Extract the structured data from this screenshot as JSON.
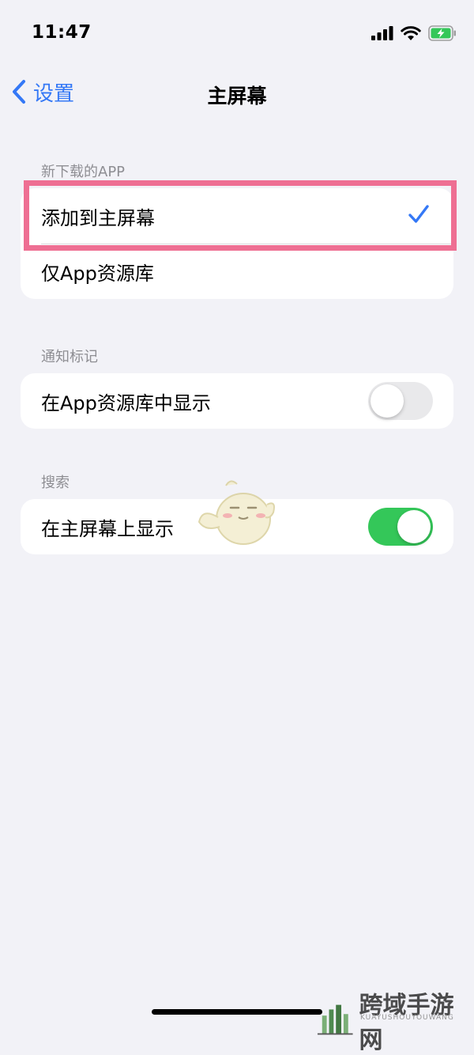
{
  "status_bar": {
    "time": "11:47"
  },
  "nav": {
    "back_label": "设置",
    "title": "主屏幕"
  },
  "sections": [
    {
      "header": "新下载的APP",
      "rows": [
        {
          "label": "添加到主屏幕",
          "selected": true
        },
        {
          "label": "仅App资源库",
          "selected": false
        }
      ]
    },
    {
      "header": "通知标记",
      "rows": [
        {
          "label": "在App资源库中显示",
          "toggle": false
        }
      ]
    },
    {
      "header": "搜索",
      "rows": [
        {
          "label": "在主屏幕上显示",
          "toggle": true
        }
      ]
    }
  ],
  "watermark": {
    "text": "跨域手游网",
    "sub": "KUAYUSHOUYOUWANG"
  },
  "colors": {
    "accent": "#3478f6",
    "toggle_on": "#34c759",
    "highlight": "#ee6f93",
    "background": "#f2f2f7"
  }
}
